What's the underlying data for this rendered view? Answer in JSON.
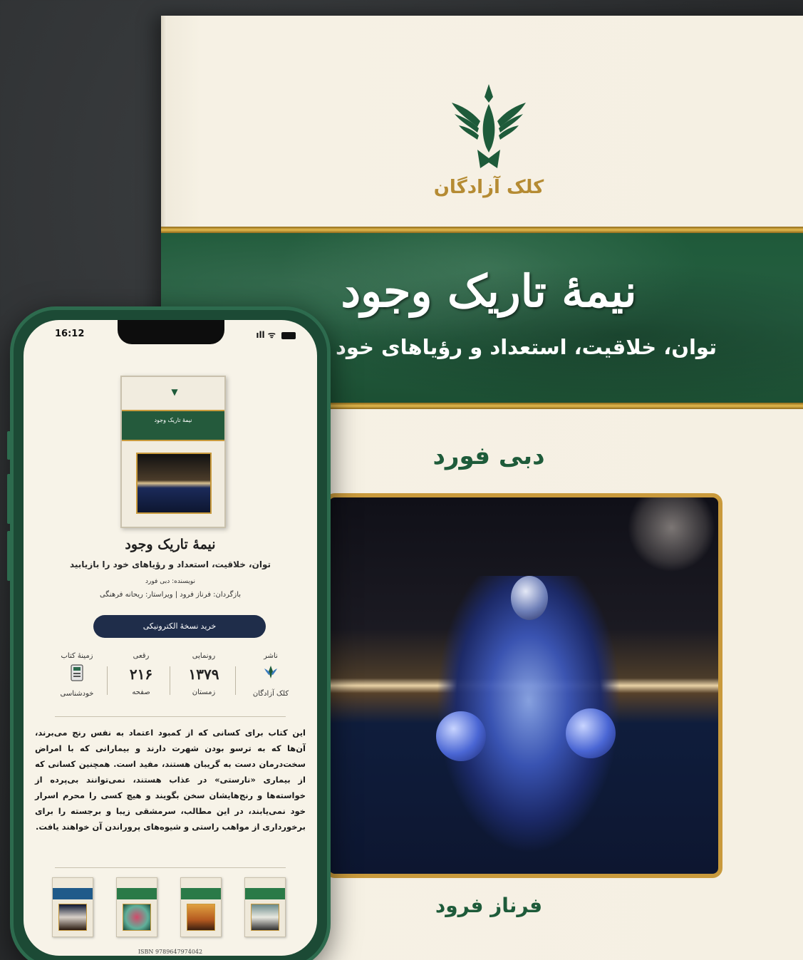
{
  "book": {
    "publisher": "کلک آزادگان",
    "title": "نیمهٔ تاریک وجود",
    "subtitle": "توان، خلاقیت، استعداد و رؤیاهای خود را",
    "author": "دبی فورد",
    "translator": "فرناز فرود"
  },
  "phone": {
    "status": {
      "time": "16:12",
      "icons": "ıll ᯤ"
    },
    "mini_cover_title": "نیمهٔ تاریک وجود",
    "title": "نیمهٔ تاریک وجود",
    "subtitle": "توان، خلاقیت، استعداد و رؤیاهای خود را بازیابید",
    "author_line": "نویسنده: دبی فورد",
    "credits_line": "بازگردان: فرناز فرود | ویراستار: ریحانه فرهنگی",
    "buy_button": "خرید نسخهٔ الکترونیکی",
    "stats": [
      {
        "label": "ناشر",
        "value": "",
        "caption": "کلک آزادگان",
        "icon": "publisher-logo-icon"
      },
      {
        "label": "رونمایی",
        "value": "۱۳۷۹",
        "caption": "زمستان"
      },
      {
        "label": "رقعی",
        "value": "۲۱۶",
        "caption": "صفحه"
      },
      {
        "label": "زمینهٔ کتاب",
        "value": "",
        "caption": "خودشناسی",
        "icon": "calculator-icon"
      }
    ],
    "description": "این کتاب برای کسانی که از کمبود اعتماد به نفس رنج می‌برند، آن‌ها که به ترسو بودن شهرت دارند و بیمارانی که با امراض سخت‌درمان دست به گریبان هستند، مفید است. همچنین کسانی که از بیماری «نارستی» در عذاب هستند، نمی‌توانند بی‌پرده از خواسته‌ها و رنج‌هایشان سخن بگویند و هیچ کسی را محرم اسرار خود نمی‌یابند، در این مطالب، سرمشقی زیبا و برجسته را برای برخورداری از مواهب راستی و شیوه‌های پروراندن آن خواهند یافت.",
    "related_books": [
      {
        "band": "#1f5a8a",
        "image": [
          "#0b1530",
          "#d8d0c8",
          "#2a1a10"
        ]
      },
      {
        "band": "#2a7a48",
        "image": [
          "#5fb09a",
          "#d24a6a",
          "#1d4a3a"
        ]
      },
      {
        "band": "#2a7a48",
        "image": [
          "#e0a040",
          "#b55a20",
          "#3a2010"
        ]
      },
      {
        "band": "#2a7a48",
        "image": [
          "#6a8a8a",
          "#e8e8e0",
          "#303030"
        ]
      }
    ],
    "isbn": "ISBN 9789647974042"
  },
  "colors": {
    "green": "#1e5b3a",
    "gold": "#c99a3c",
    "navy_button": "#1f2d4a",
    "paper": "#f5f0e3"
  }
}
